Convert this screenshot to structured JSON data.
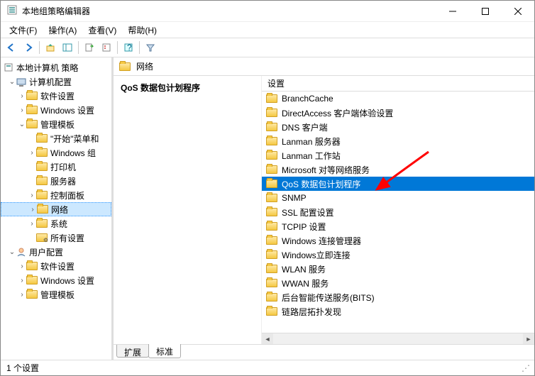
{
  "window": {
    "title": "本地组策略编辑器"
  },
  "menus": [
    {
      "label": "文件(F)"
    },
    {
      "label": "操作(A)"
    },
    {
      "label": "查看(V)"
    },
    {
      "label": "帮助(H)"
    }
  ],
  "tree": {
    "root": "本地计算机 策略",
    "computer": "计算机配置",
    "user": "用户配置",
    "nodes": {
      "software": "软件设置",
      "windows": "Windows 设置",
      "admin": "管理模板",
      "start": "\"开始\"菜单和",
      "wincomp": "Windows 组",
      "printer": "打印机",
      "server": "服务器",
      "ctlpanel": "控制面板",
      "network": "网络",
      "system": "系统",
      "allsettings": "所有设置",
      "software2": "软件设置",
      "windows2": "Windows 设置",
      "admin2": "管理模板"
    }
  },
  "detail": {
    "path_label": "网络",
    "heading": "QoS 数据包计划程序",
    "column": "设置",
    "items": [
      "BranchCache",
      "DirectAccess 客户端体验设置",
      "DNS 客户端",
      "Lanman 服务器",
      "Lanman 工作站",
      "Microsoft 对等网络服务",
      "QoS 数据包计划程序",
      "SNMP",
      "SSL 配置设置",
      "TCPIP 设置",
      "Windows 连接管理器",
      "Windows立即连接",
      "WLAN 服务",
      "WWAN 服务",
      "后台智能传送服务(BITS)",
      "链路层拓扑发现"
    ],
    "selected_index": 6,
    "tabs": {
      "extended": "扩展",
      "standard": "标准"
    }
  },
  "status": {
    "text": "1 个设置"
  }
}
